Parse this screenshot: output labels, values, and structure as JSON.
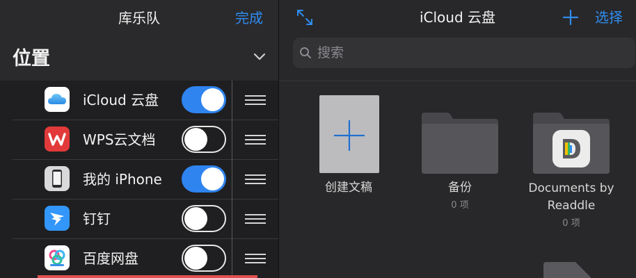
{
  "left": {
    "title": "库乐队",
    "done_label": "完成",
    "section_title": "位置",
    "rows": [
      {
        "label": "iCloud 云盘",
        "on": true,
        "icon": "icloud-icon"
      },
      {
        "label": "WPS云文档",
        "on": false,
        "icon": "wps-icon"
      },
      {
        "label": "我的 iPhone",
        "on": true,
        "icon": "iphone-icon"
      },
      {
        "label": "钉钉",
        "on": false,
        "icon": "dingtalk-icon"
      },
      {
        "label": "百度网盘",
        "on": false,
        "icon": "baidu-netdisk-icon"
      }
    ]
  },
  "right": {
    "title": "iCloud 云盘",
    "select_label": "选择",
    "search_placeholder": "搜索",
    "items": [
      {
        "name": "创建文稿",
        "count": ""
      },
      {
        "name": "备份",
        "count": "0 项"
      },
      {
        "name_line1": "Documents by",
        "name_line2": "Readdle",
        "count": "0 项"
      }
    ]
  },
  "colors": {
    "accent": "#2f8cf0",
    "toggle_on": "#2f84f0"
  }
}
